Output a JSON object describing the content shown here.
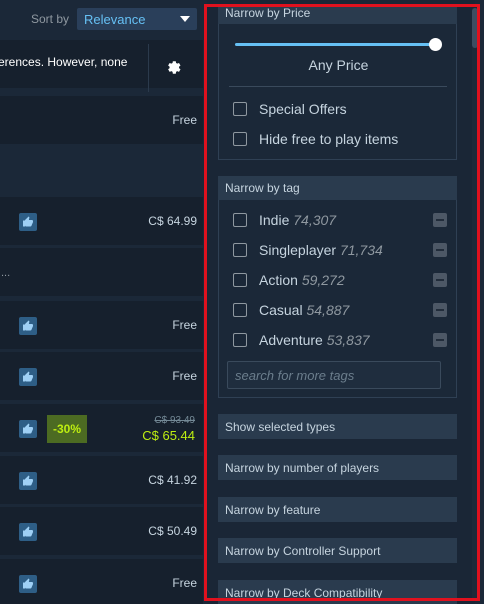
{
  "sort": {
    "label": "Sort by",
    "value": "Relevance"
  },
  "notice": {
    "text": "erences. However, none"
  },
  "icons": {
    "settings": "gear-icon",
    "thumb": "thumbs-up-icon",
    "dropdown": "chevron-down-icon"
  },
  "results": [
    {
      "price": "Free"
    },
    {
      "thumb": true,
      "price": "C$ 64.99"
    },
    {
      "ellipsis": "..."
    },
    {
      "thumb": true,
      "price": "Free"
    },
    {
      "thumb": true,
      "price": "Free"
    },
    {
      "thumb": true,
      "discount": "-30%",
      "original": "C$ 93.49",
      "final": "C$ 65.44"
    },
    {
      "thumb": true,
      "price": "C$ 41.92"
    },
    {
      "thumb": true,
      "price": "C$ 50.49"
    },
    {
      "thumb": true,
      "price": "Free"
    }
  ],
  "filters": {
    "price": {
      "header": "Narrow by Price",
      "slider_value_fraction": 1.0,
      "value_text": "Any Price",
      "options": [
        "Special Offers",
        "Hide free to play items"
      ]
    },
    "tag": {
      "header": "Narrow by tag",
      "tags": [
        {
          "name": "Indie",
          "count": "74,307"
        },
        {
          "name": "Singleplayer",
          "count": "71,734"
        },
        {
          "name": "Action",
          "count": "59,272"
        },
        {
          "name": "Casual",
          "count": "54,887"
        },
        {
          "name": "Adventure",
          "count": "53,837"
        }
      ],
      "search_placeholder": "search for more tags"
    },
    "collapsed": [
      "Show selected types",
      "Narrow by number of players",
      "Narrow by feature",
      "Narrow by Controller Support",
      "Narrow by Deck Compatibility"
    ]
  },
  "colors": {
    "background": "#1b2838",
    "accent": "#66c0f4",
    "discount_green": "#beee11",
    "highlight_frame": "#e0111e"
  }
}
